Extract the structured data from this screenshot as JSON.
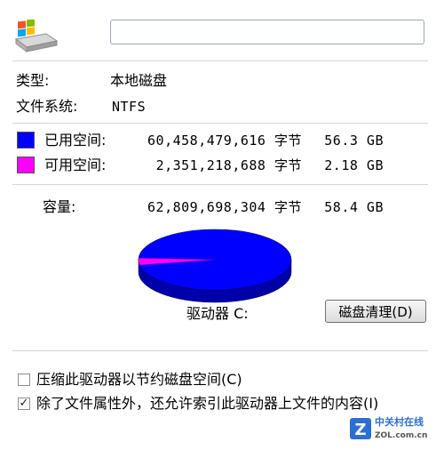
{
  "header": {
    "drive_icon": "drive-icon",
    "name_value": ""
  },
  "info": {
    "type_label": "类型:",
    "type_value": "本地磁盘",
    "fs_label": "文件系统:",
    "fs_value": "NTFS"
  },
  "space": {
    "used": {
      "label": "已用空间:",
      "bytes": "60,458,479,616 字节",
      "size": "56.3 GB",
      "color": "#0000ff"
    },
    "free": {
      "label": "可用空间:",
      "bytes": "2,351,218,688 字节",
      "size": "2.18 GB",
      "color": "#ff00ff"
    },
    "capacity": {
      "label": "容量:",
      "bytes": "62,809,698,304 字节",
      "size": "58.4 GB"
    }
  },
  "pie": {
    "used_fraction": 0.9626,
    "free_fraction": 0.0374
  },
  "drive_label": "驱动器 C:",
  "cleanup_button": "磁盘清理(D)",
  "options": {
    "compress": {
      "label": "压缩此驱动器以节约磁盘空间(C)",
      "checked": false
    },
    "index": {
      "label": "除了文件属性外，还允许索引此驱动器上文件的内容(I)",
      "checked": true
    }
  },
  "watermark": {
    "logo_text": "Z",
    "site_cn": "中关村在线",
    "site_url": "ZOL.com.cn"
  }
}
